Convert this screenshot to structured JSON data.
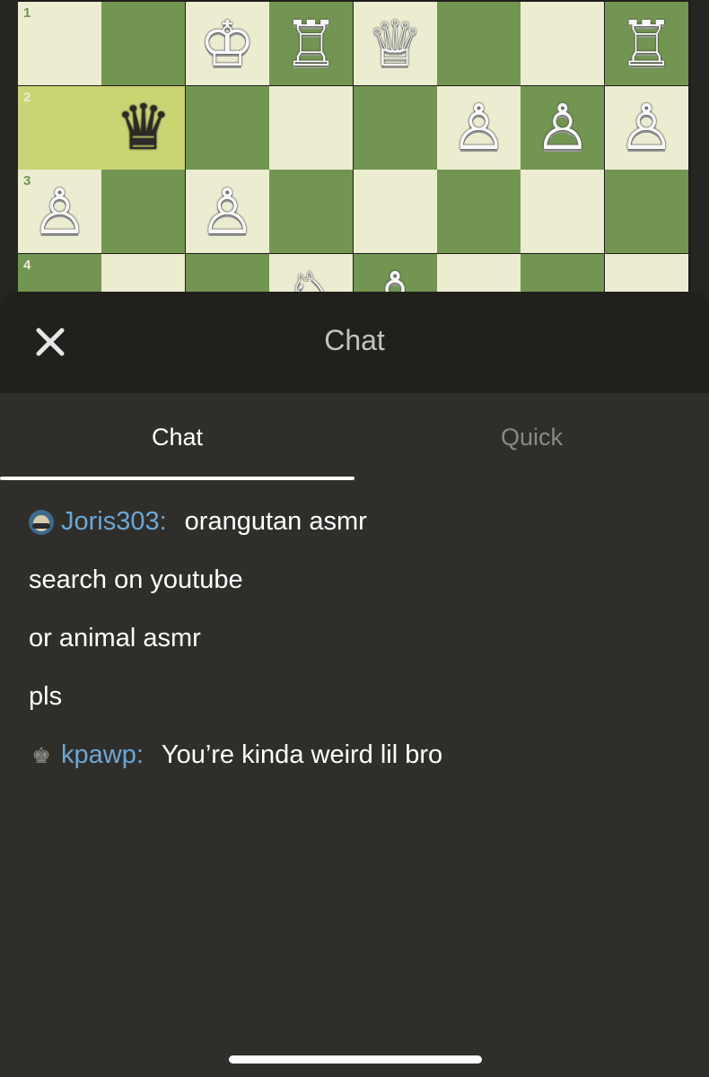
{
  "board": {
    "ranks": [
      {
        "label": "1",
        "squares": [
          {
            "color": "light",
            "piece": ""
          },
          {
            "color": "dark",
            "piece": ""
          },
          {
            "color": "light",
            "piece": "♔",
            "side": "w",
            "name": "white-king"
          },
          {
            "color": "dark",
            "piece": "♖",
            "side": "w",
            "name": "white-rook"
          },
          {
            "color": "light",
            "piece": "♕",
            "side": "w",
            "name": "white-queen"
          },
          {
            "color": "dark",
            "piece": ""
          },
          {
            "color": "light",
            "piece": ""
          },
          {
            "color": "dark",
            "piece": "♖",
            "side": "w",
            "name": "white-rook"
          }
        ]
      },
      {
        "label": "2",
        "squares": [
          {
            "color": "hl",
            "piece": ""
          },
          {
            "color": "hl",
            "piece": "♛",
            "side": "b",
            "name": "black-queen"
          },
          {
            "color": "dark",
            "piece": ""
          },
          {
            "color": "light",
            "piece": ""
          },
          {
            "color": "dark",
            "piece": ""
          },
          {
            "color": "light",
            "piece": "♙",
            "side": "w",
            "name": "white-pawn"
          },
          {
            "color": "dark",
            "piece": "♙",
            "side": "w",
            "name": "white-pawn"
          },
          {
            "color": "light",
            "piece": "♙",
            "side": "w",
            "name": "white-pawn"
          }
        ]
      },
      {
        "label": "3",
        "squares": [
          {
            "color": "light",
            "piece": "♙",
            "side": "w",
            "name": "white-pawn"
          },
          {
            "color": "dark",
            "piece": ""
          },
          {
            "color": "light",
            "piece": "♙",
            "side": "w",
            "name": "white-pawn"
          },
          {
            "color": "dark",
            "piece": ""
          },
          {
            "color": "light",
            "piece": ""
          },
          {
            "color": "dark",
            "piece": ""
          },
          {
            "color": "light",
            "piece": ""
          },
          {
            "color": "dark",
            "piece": ""
          }
        ]
      },
      {
        "label": "4",
        "squares": [
          {
            "color": "dark",
            "piece": ""
          },
          {
            "color": "light",
            "piece": ""
          },
          {
            "color": "dark",
            "piece": ""
          },
          {
            "color": "light",
            "piece": "♘",
            "side": "w",
            "name": "white-knight"
          },
          {
            "color": "dark",
            "piece": "♙",
            "side": "w",
            "name": "white-pawn"
          },
          {
            "color": "light",
            "piece": ""
          },
          {
            "color": "dark",
            "piece": ""
          },
          {
            "color": "light",
            "piece": ""
          }
        ]
      }
    ]
  },
  "header": {
    "title": "Chat",
    "close_icon": "close-icon"
  },
  "tabs": [
    {
      "label": "Chat",
      "active": true
    },
    {
      "label": "Quick",
      "active": false
    }
  ],
  "messages": [
    {
      "user": "Joris303:",
      "icon": "avatar",
      "text": "orangutan asmr"
    },
    {
      "user": "",
      "icon": "",
      "text": "search on youtube"
    },
    {
      "user": "",
      "icon": "",
      "text": "or animal asmr"
    },
    {
      "user": "",
      "icon": "",
      "text": "pls"
    },
    {
      "user": "kpawp:",
      "icon": "crown",
      "text": "You’re kinda weird lil bro"
    }
  ],
  "colors": {
    "board_light": "#ebecd0",
    "board_dark": "#739552",
    "highlight": "#cbd473",
    "username": "#6aa7d6"
  }
}
